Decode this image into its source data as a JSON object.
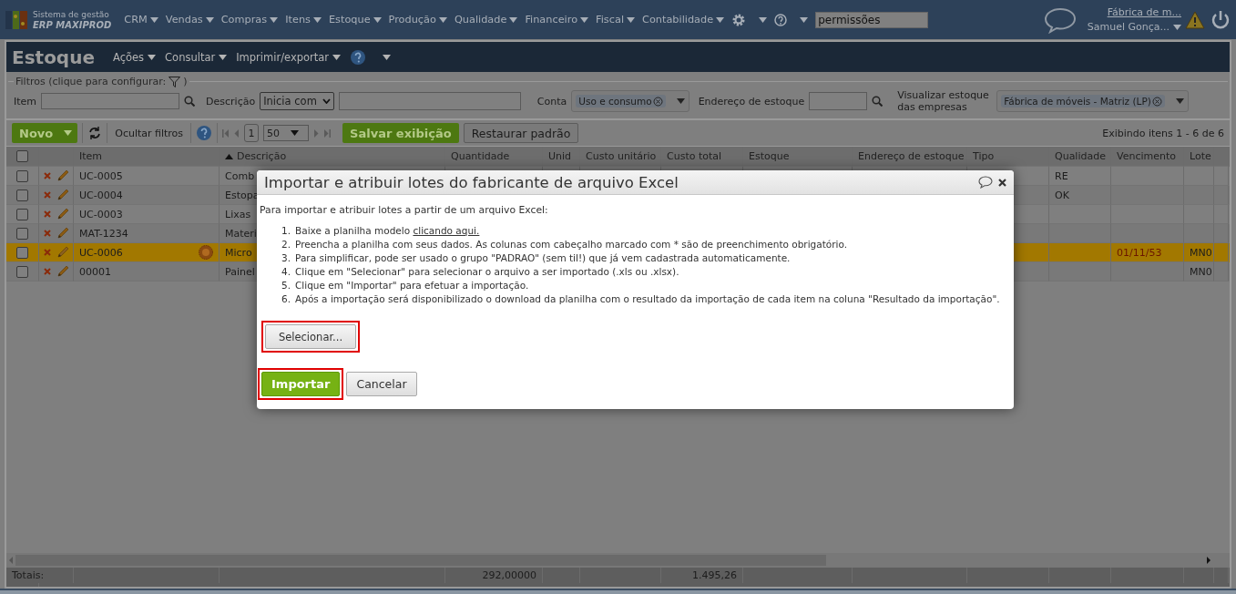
{
  "nav": {
    "logo": {
      "line1": "Sistema de gestão",
      "line2": "ERP MAXIPROD"
    },
    "menus": [
      "CRM",
      "Vendas",
      "Compras",
      "Itens",
      "Estoque",
      "Produção",
      "Qualidade",
      "Financeiro",
      "Fiscal",
      "Contabilidade"
    ],
    "search_value": "permissões",
    "company": "Fábrica de m...",
    "user": "Samuel Gonça..."
  },
  "page": {
    "title": "Estoque",
    "menus": [
      "Ações",
      "Consultar",
      "Imprimir/exportar"
    ]
  },
  "filters": {
    "legend": "Filtros (clique para configurar:",
    "legend_end": ")",
    "item_label": "Item",
    "description_label": "Descrição",
    "description_mode": "Inicia com",
    "account_label": "Conta",
    "account_tag": "Uso e consumo",
    "address_label": "Endereço de estoque",
    "companies_label": "Visualizar estoque das empresas",
    "companies_tag": "Fábrica de móveis - Matriz (LP)"
  },
  "toolbar": {
    "new": "Novo",
    "hide_filters": "Ocultar filtros",
    "page": "1",
    "page_size": "50",
    "save": "Salvar exibição",
    "restore": "Restaurar padrão",
    "summary": "Exibindo itens 1 - 6 de 6"
  },
  "table": {
    "all_checked": false,
    "columns": [
      {
        "label": "Item",
        "sorted": false
      },
      {
        "label": "Descrição",
        "sorted": true
      },
      {
        "label": "Quantidade",
        "sorted": false
      },
      {
        "label": "Unid",
        "sorted": false
      },
      {
        "label": "Custo unitário",
        "sorted": false
      },
      {
        "label": "Custo total",
        "sorted": false
      },
      {
        "label": "Estoque",
        "sorted": false
      },
      {
        "label": "Endereço de estoque",
        "sorted": false
      },
      {
        "label": "Tipo",
        "sorted": false
      },
      {
        "label": "Qualidade",
        "sorted": false
      },
      {
        "label": "Vencimento",
        "sorted": false
      },
      {
        "label": "Lote",
        "sorted": false
      }
    ],
    "rows": [
      {
        "selected": false,
        "checked": false,
        "badge": false,
        "item": "UC-0005",
        "description": "Comb",
        "quality": "RE"
      },
      {
        "selected": false,
        "checked": false,
        "badge": false,
        "item": "UC-0004",
        "description": "Estopa",
        "quality": "OK"
      },
      {
        "selected": false,
        "checked": false,
        "badge": false,
        "item": "UC-0003",
        "description": "Lixas"
      },
      {
        "selected": false,
        "checked": false,
        "badge": false,
        "item": "MAT-1234",
        "description": "Materi"
      },
      {
        "selected": true,
        "checked": false,
        "badge": true,
        "item": "UC-0006",
        "description": "Micro",
        "due": "01/11/53",
        "lot": "MN0"
      },
      {
        "selected": false,
        "checked": false,
        "badge": false,
        "item": "00001",
        "description": "Painel",
        "lot": "MN0"
      }
    ],
    "totals": {
      "label": "Totais:",
      "quantity": "292,00000",
      "total_cost": "1.495,26"
    }
  },
  "dialog": {
    "title": "Importar e atribuir lotes do fabricante de arquivo Excel",
    "intro": "Para importar e atribuir lotes a partir de um arquivo Excel:",
    "steps": [
      {
        "number": "1.",
        "text": "Baixe a planilha modelo",
        "link": "clicando aqui."
      },
      {
        "number": "2.",
        "text": "Preencha a planilha com seus dados. As colunas com cabeçalho marcado com * são de preenchimento obrigatório."
      },
      {
        "number": "3.",
        "text": "Para simplificar, pode ser usado o grupo \"PADRAO\" (sem til!) que já vem cadastrada automaticamente."
      },
      {
        "number": "4.",
        "text": "Clique em \"Selecionar\" para selecionar o arquivo a ser importado (.xls ou .xlsx)."
      },
      {
        "number": "5.",
        "text": "Clique em \"Importar\" para efetuar a importação."
      },
      {
        "number": "6.",
        "text": "Após a importação será disponibilizado o download da planilha com o resultado da importação de cada item na coluna \"Resultado da importação\"."
      }
    ],
    "buttons": [
      {
        "label": "Selecionar...",
        "kind": "select",
        "highlighted": true
      },
      {
        "label": "Importar",
        "kind": "primary",
        "highlighted": true
      },
      {
        "label": "Cancelar",
        "kind": "secondary",
        "highlighted": false
      }
    ]
  }
}
